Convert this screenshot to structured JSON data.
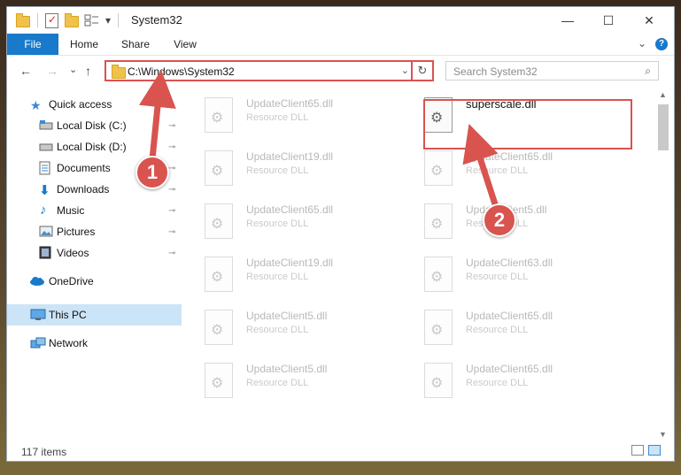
{
  "window": {
    "title": "System32",
    "controls": {
      "minimize": "—",
      "maximize": "☐",
      "close": "✕"
    },
    "quick_access_toolbar": [
      "folder-icon",
      "properties-icon",
      "new-folder-icon",
      "layout-icon"
    ],
    "chevron": "▾"
  },
  "ribbon": {
    "tabs": [
      "File",
      "Home",
      "Share",
      "View"
    ],
    "expand": "⌄",
    "help": "?"
  },
  "nav": {
    "back": "←",
    "forward": "→",
    "recent": "⌄",
    "up": "↑",
    "address": "C:\\Windows\\System32",
    "address_dropdown": "⌄",
    "refresh": "↻",
    "search_placeholder": "Search System32",
    "search_icon": "⌕"
  },
  "sidebar": {
    "items": [
      {
        "label": "Quick access",
        "icon": "star-icon",
        "pinned": false
      },
      {
        "label": "Local Disk (C:)",
        "icon": "drive-icon",
        "pinned": true
      },
      {
        "label": "Local Disk (D:)",
        "icon": "drive-icon",
        "pinned": true
      },
      {
        "label": "Documents",
        "icon": "documents-icon",
        "pinned": true
      },
      {
        "label": "Downloads",
        "icon": "download-icon",
        "pinned": true
      },
      {
        "label": "Music",
        "icon": "music-icon",
        "pinned": true
      },
      {
        "label": "Pictures",
        "icon": "pictures-icon",
        "pinned": true
      },
      {
        "label": "Videos",
        "icon": "videos-icon",
        "pinned": true
      },
      {
        "label": "OneDrive",
        "icon": "cloud-icon",
        "pinned": false
      },
      {
        "label": "This PC",
        "icon": "computer-icon",
        "pinned": false,
        "selected": true
      },
      {
        "label": "Network",
        "icon": "network-icon",
        "pinned": false
      }
    ],
    "pin_glyph": "📌"
  },
  "files": {
    "left_column": [
      {
        "name": "UpdateClient65.dll",
        "type": "Resource DLL"
      },
      {
        "name": "UpdateClient19.dll",
        "type": "Resource DLL"
      },
      {
        "name": "UpdateClient65.dll",
        "type": "Resource DLL"
      },
      {
        "name": "UpdateClient19.dll",
        "type": "Resource DLL"
      },
      {
        "name": "UpdateClient5.dll",
        "type": "Resource DLL"
      },
      {
        "name": "UpdateClient5.dll",
        "type": "Resource DLL"
      }
    ],
    "right_column": [
      {
        "name": "superscale.dll",
        "type": "",
        "highlighted": true
      },
      {
        "name": "UpdateClient65.dll",
        "type": "Resource DLL"
      },
      {
        "name": "UpdateClient5.dll",
        "type": "Resource DLL"
      },
      {
        "name": "UpdateClient63.dll",
        "type": "Resource DLL"
      },
      {
        "name": "UpdateClient65.dll",
        "type": "Resource DLL"
      },
      {
        "name": "UpdateClient65.dll",
        "type": "Resource DLL"
      }
    ]
  },
  "status": {
    "item_count": "117 items"
  },
  "annotations": {
    "step1": "1",
    "step2": "2",
    "color": "#d9534f"
  }
}
